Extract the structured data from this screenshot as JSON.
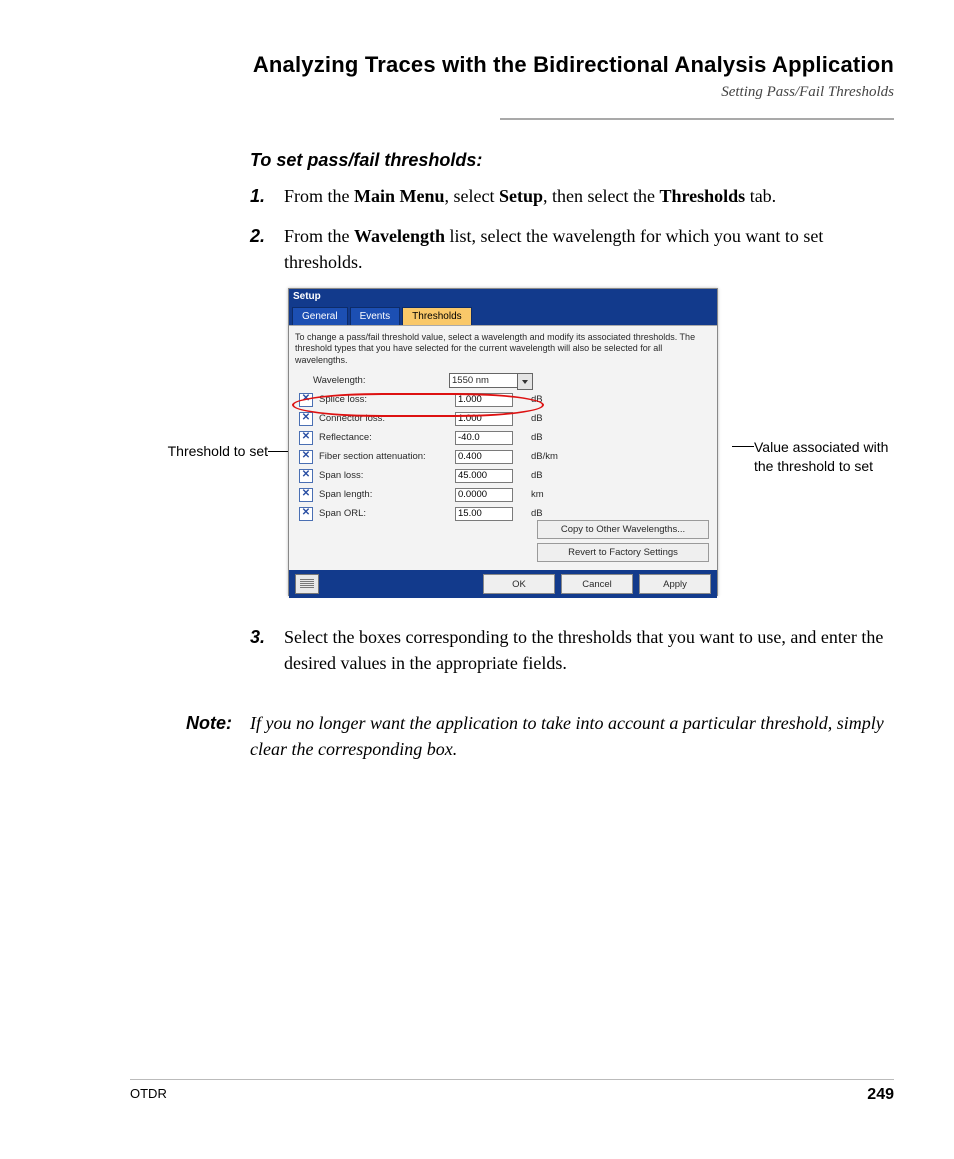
{
  "header": {
    "title": "Analyzing Traces with the Bidirectional Analysis Application",
    "subtitle": "Setting Pass/Fail Thresholds"
  },
  "procedure": {
    "title": "To set pass/fail thresholds:",
    "steps": [
      {
        "num": "1.",
        "parts": [
          "From the ",
          "Main Menu",
          ", select ",
          "Setup",
          ", then select the ",
          "Thresholds",
          " tab."
        ]
      },
      {
        "num": "2.",
        "parts": [
          "From the ",
          "Wavelength",
          " list, select the wavelength for which you want to set thresholds."
        ]
      },
      {
        "num": "3.",
        "text": "Select the boxes corresponding to the thresholds that you want to use, and enter the desired values in the appropriate fields."
      }
    ]
  },
  "callouts": {
    "left": "Threshold to set",
    "right": "Value associated with the threshold to set"
  },
  "dialog": {
    "title": "Setup",
    "tabs": [
      "General",
      "Events",
      "Thresholds"
    ],
    "desc": "To change a pass/fail threshold value, select a wavelength and modify its associated thresholds. The threshold types that you have selected for the current wavelength will also be selected for all wavelengths.",
    "wavelength": {
      "label": "Wavelength:",
      "value": "1550 nm"
    },
    "checkmark": "✕",
    "rows": [
      {
        "label": "Splice loss:",
        "value": "1.000",
        "unit": "dB"
      },
      {
        "label": "Connector loss:",
        "value": "1.000",
        "unit": "dB"
      },
      {
        "label": "Reflectance:",
        "value": "-40.0",
        "unit": "dB"
      },
      {
        "label": "Fiber section attenuation:",
        "value": "0.400",
        "unit": "dB/km"
      },
      {
        "label": "Span loss:",
        "value": "45.000",
        "unit": "dB"
      },
      {
        "label": "Span length:",
        "value": "0.0000",
        "unit": "km"
      },
      {
        "label": "Span ORL:",
        "value": "15.00",
        "unit": "dB"
      }
    ],
    "side_buttons": [
      "Copy to Other Wavelengths...",
      "Revert to Factory Settings"
    ],
    "footer_buttons": [
      "OK",
      "Cancel",
      "Apply"
    ]
  },
  "note": {
    "label": "Note:",
    "text": "If you no longer want the application to take into account a particular threshold, simply clear the corresponding box."
  },
  "footer": {
    "product": "OTDR",
    "page": "249"
  }
}
